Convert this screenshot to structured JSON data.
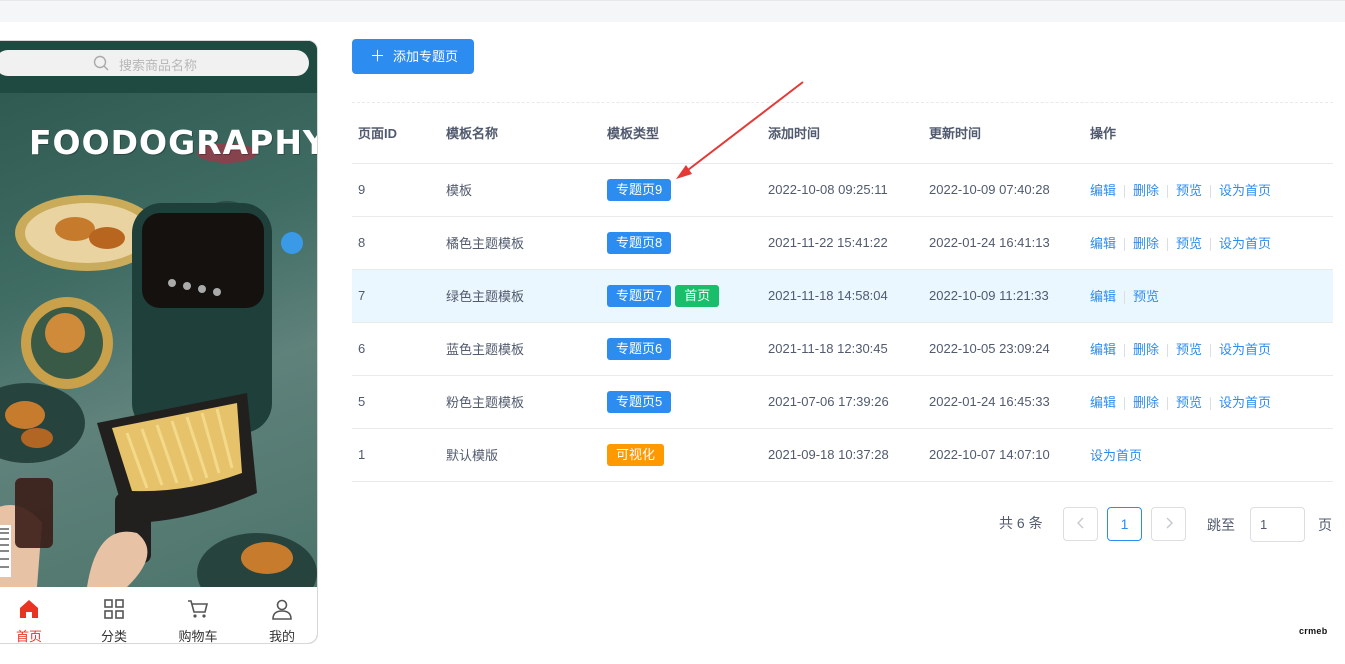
{
  "phone": {
    "search_placeholder": "搜索商品名称",
    "poster_title": "FOODOGRAPHY.",
    "tabs": [
      {
        "label": "首页",
        "icon": "home-icon",
        "active": true
      },
      {
        "label": "分类",
        "icon": "grid-icon",
        "active": false
      },
      {
        "label": "购物车",
        "icon": "cart-icon",
        "active": false
      },
      {
        "label": "我的",
        "icon": "user-icon",
        "active": false
      }
    ]
  },
  "toolbar": {
    "add_label": "添加专题页"
  },
  "table": {
    "headers": {
      "id": "页面ID",
      "name": "模板名称",
      "type": "模板类型",
      "created": "添加时间",
      "updated": "更新时间",
      "ops": "操作"
    },
    "ops": {
      "edit": "编辑",
      "delete": "删除",
      "preview": "预览",
      "set_home": "设为首页"
    },
    "rows": [
      {
        "id": "9",
        "name": "模板",
        "tag": "专题页9",
        "tag2": "",
        "created": "2022-10-08 09:25:11",
        "updated": "2022-10-09 07:40:28"
      },
      {
        "id": "8",
        "name": "橘色主题模板",
        "tag": "专题页8",
        "tag2": "",
        "created": "2021-11-22 15:41:22",
        "updated": "2022-01-24 16:41:13"
      },
      {
        "id": "7",
        "name": "绿色主题模板",
        "tag": "专题页7",
        "tag2": "首页",
        "created": "2021-11-18 14:58:04",
        "updated": "2022-10-09 11:21:33"
      },
      {
        "id": "6",
        "name": "蓝色主题模板",
        "tag": "专题页6",
        "tag2": "",
        "created": "2021-11-18 12:30:45",
        "updated": "2022-10-05 23:09:24"
      },
      {
        "id": "5",
        "name": "粉色主题模板",
        "tag": "专题页5",
        "tag2": "",
        "created": "2021-07-06 17:39:26",
        "updated": "2022-01-24 16:45:33"
      },
      {
        "id": "1",
        "name": "默认模版",
        "tag": "可视化",
        "tag2": "",
        "created": "2021-09-18 10:37:28",
        "updated": "2022-10-07 14:07:10"
      }
    ]
  },
  "pagination": {
    "total": "共 6 条",
    "current": "1",
    "jump_label": "跳至",
    "jump_value": "1",
    "page_label": "页"
  },
  "watermark": "crmeb",
  "colors": {
    "primary": "#2d8cf0",
    "success": "#19be6b",
    "warning": "#ff9900",
    "highlight_row": "#ebf7ff",
    "annotation_arrow": "#e53935"
  }
}
